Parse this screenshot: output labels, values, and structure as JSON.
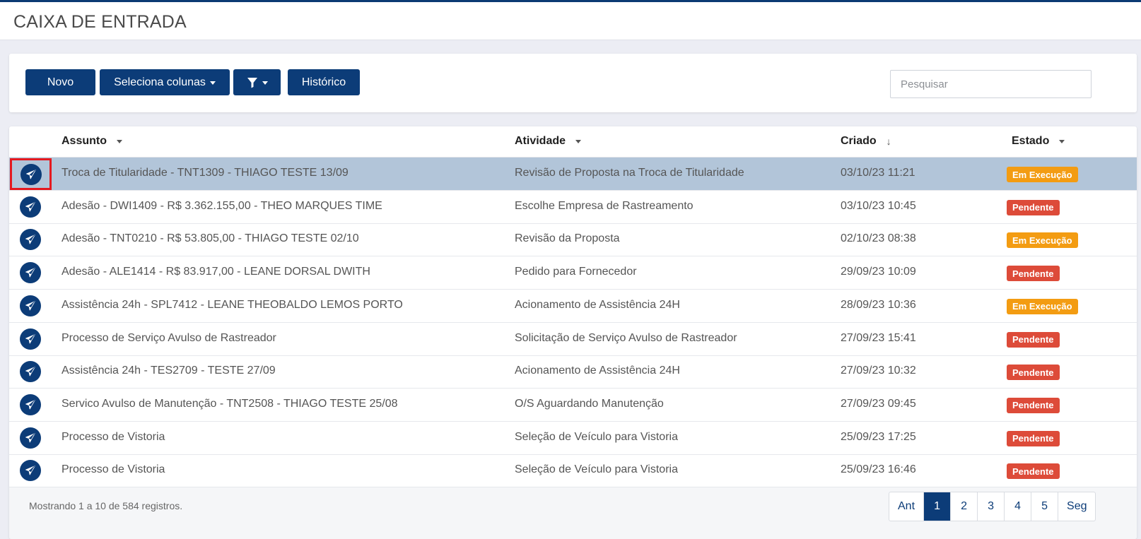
{
  "header": {
    "title": "CAIXA DE ENTRADA"
  },
  "toolbar": {
    "new_label": "Novo",
    "columns_label": "Seleciona colunas",
    "filter_icon": "funnel-icon",
    "history_label": "Histórico",
    "search_placeholder": "Pesquisar"
  },
  "table": {
    "columns": [
      "Assunto",
      "Atividade",
      "Criado",
      "Estado"
    ],
    "rows": [
      {
        "assunto": "Troca de Titularidade - TNT1309 - THIAGO TESTE 13/09",
        "atividade": "Revisão de Proposta na Troca de Titularidade",
        "criado": "03/10/23 11:21",
        "estado": "Em Execução"
      },
      {
        "assunto": "Adesão - DWI1409 - R$ 3.362.155,00 - THEO MARQUES TIME",
        "atividade": "Escolhe Empresa de Rastreamento",
        "criado": "03/10/23 10:45",
        "estado": "Pendente"
      },
      {
        "assunto": "Adesão - TNT0210 - R$ 53.805,00 - THIAGO TESTE 02/10",
        "atividade": "Revisão da Proposta",
        "criado": "02/10/23 08:38",
        "estado": "Em Execução"
      },
      {
        "assunto": "Adesão - ALE1414 - R$ 83.917,00 - LEANE DORSAL DWITH",
        "atividade": "Pedido para Fornecedor",
        "criado": "29/09/23 10:09",
        "estado": "Pendente"
      },
      {
        "assunto": "Assistência 24h - SPL7412 - LEANE THEOBALDO LEMOS PORTO",
        "atividade": "Acionamento de Assistência 24H",
        "criado": "28/09/23 10:36",
        "estado": "Em Execução"
      },
      {
        "assunto": "Processo de Serviço Avulso de Rastreador",
        "atividade": "Solicitação de Serviço Avulso de Rastreador",
        "criado": "27/09/23 15:41",
        "estado": "Pendente"
      },
      {
        "assunto": "Assistência 24h - TES2709 - TESTE 27/09",
        "atividade": "Acionamento de Assistência 24H",
        "criado": "27/09/23 10:32",
        "estado": "Pendente"
      },
      {
        "assunto": "Servico Avulso de Manutenção - TNT2508 - THIAGO TESTE 25/08",
        "atividade": "O/S Aguardando Manutenção",
        "criado": "27/09/23 09:45",
        "estado": "Pendente"
      },
      {
        "assunto": "Processo de Vistoria",
        "atividade": "Seleção de Veículo para Vistoria",
        "criado": "25/09/23 17:25",
        "estado": "Pendente"
      },
      {
        "assunto": "Processo de Vistoria",
        "atividade": "Seleção de Veículo para Vistoria",
        "criado": "25/09/23 16:46",
        "estado": "Pendente"
      }
    ],
    "row_icon": "send-icon"
  },
  "footer": {
    "info": "Mostrando 1 a 10 de 584 registros.",
    "pagination": [
      "Ant",
      "1",
      "2",
      "3",
      "4",
      "5",
      "Seg"
    ],
    "active_page": "1"
  },
  "colors": {
    "primary": "#0c3c78",
    "selected_row": "#b2c5d9",
    "badge_exec": "#f39c12",
    "badge_pend": "#dd4b39",
    "highlight_border": "#e5191f"
  }
}
